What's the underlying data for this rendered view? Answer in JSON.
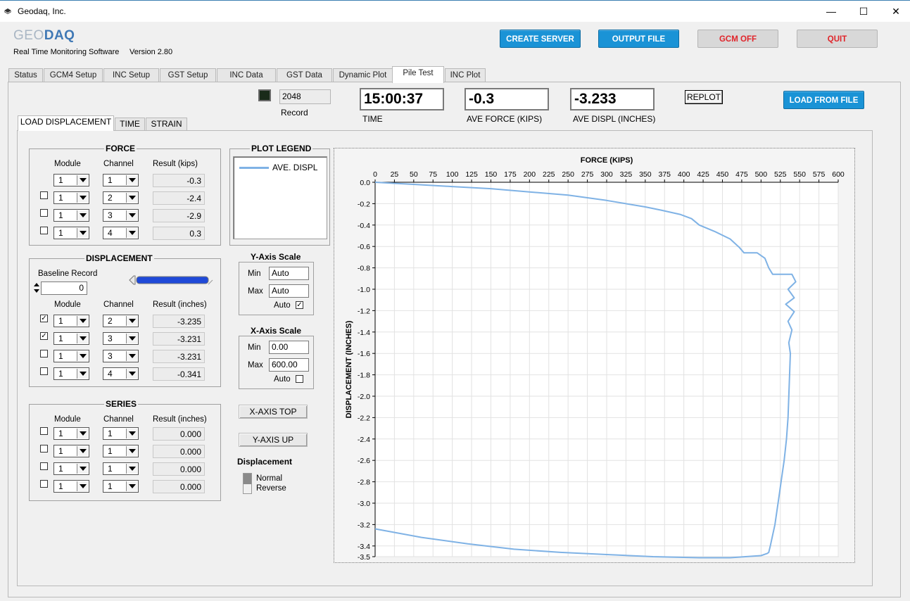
{
  "window": {
    "title": "Geodaq, Inc.",
    "minimize": "—",
    "maximize": "☐",
    "close": "✕"
  },
  "header": {
    "logo_geo": "GEO",
    "logo_daq": "DAQ",
    "subtitle": "Real Time Monitoring Software",
    "version": "Version 2.80",
    "buttons": {
      "create_server": "CREATE SERVER",
      "output_file": "OUTPUT FILE",
      "gcm_off": "GCM OFF",
      "quit": "QUIT"
    }
  },
  "tabs": [
    "Status",
    "GCM4 Setup",
    "INC Setup",
    "GST Setup",
    "INC Data",
    "GST Data",
    "Dynamic Plot",
    "Pile Test",
    "INC Plot"
  ],
  "readouts": {
    "record_value": "2048",
    "record_label": "Record",
    "time_value": "15:00:37",
    "time_label": "TIME",
    "force_value": "-0.3",
    "force_label": "AVE FORCE (KIPS)",
    "displ_value": "-3.233",
    "displ_label": "AVE DISPL (INCHES)",
    "replot": "REPLOT",
    "load_from_file": "LOAD FROM FILE"
  },
  "inner_tabs": [
    "LOAD DISPLACEMENT",
    "TIME",
    "STRAIN"
  ],
  "force_group": {
    "title": "FORCE",
    "col_module": "Module",
    "col_channel": "Channel",
    "col_result": "Result (kips)",
    "rows": [
      {
        "module": "1",
        "channel": "1",
        "result": "-0.3",
        "checked": null
      },
      {
        "module": "1",
        "channel": "2",
        "result": "-2.4",
        "checked": false
      },
      {
        "module": "1",
        "channel": "3",
        "result": "-2.9",
        "checked": false
      },
      {
        "module": "1",
        "channel": "4",
        "result": "0.3",
        "checked": false
      }
    ]
  },
  "displacement_group": {
    "title": "DISPLACEMENT",
    "baseline_label": "Baseline Record",
    "baseline_value": "0",
    "col_module": "Module",
    "col_channel": "Channel",
    "col_result": "Result (inches)",
    "rows": [
      {
        "module": "1",
        "channel": "2",
        "result": "-3.235",
        "checked": true
      },
      {
        "module": "1",
        "channel": "3",
        "result": "-3.231",
        "checked": true
      },
      {
        "module": "1",
        "channel": "3",
        "result": "-3.231",
        "checked": false
      },
      {
        "module": "1",
        "channel": "4",
        "result": "-0.341",
        "checked": false
      }
    ]
  },
  "series_group": {
    "title": "SERIES",
    "col_module": "Module",
    "col_channel": "Channel",
    "col_result": "Result (inches)",
    "rows": [
      {
        "module": "1",
        "channel": "1",
        "result": "0.000",
        "checked": false
      },
      {
        "module": "1",
        "channel": "1",
        "result": "0.000",
        "checked": false
      },
      {
        "module": "1",
        "channel": "1",
        "result": "0.000",
        "checked": false
      },
      {
        "module": "1",
        "channel": "1",
        "result": "0.000",
        "checked": false
      }
    ]
  },
  "legend": {
    "title": "PLOT LEGEND",
    "entry": "AVE. DISPL",
    "color": "#7fb2e5"
  },
  "y_axis_scale": {
    "title": "Y-Axis Scale",
    "min_label": "Min",
    "min": "Auto",
    "max_label": "Max",
    "max": "Auto",
    "auto_label": "Auto",
    "auto": true
  },
  "x_axis_scale": {
    "title": "X-Axis Scale",
    "min_label": "Min",
    "min": "0.00",
    "max_label": "Max",
    "max": "600.00",
    "auto_label": "Auto",
    "auto": false
  },
  "axis_buttons": {
    "x_axis_top": "X-AXIS TOP",
    "y_axis_up": "Y-AXIS UP"
  },
  "displacement_mode": {
    "title": "Displacement",
    "normal": "Normal",
    "reverse": "Reverse",
    "selected": "Normal"
  },
  "chart_data": {
    "type": "line",
    "title": "",
    "xlabel": "FORCE (KIPS)",
    "ylabel": "DISPLACEMENT (INCHES)",
    "xlim": [
      0,
      600
    ],
    "ylim": [
      -3.5,
      0
    ],
    "x_ticks": [
      "0",
      "25",
      "50",
      "75",
      "100",
      "125",
      "150",
      "175",
      "200",
      "225",
      "250",
      "275",
      "300",
      "325",
      "350",
      "375",
      "400",
      "425",
      "450",
      "475",
      "500",
      "525",
      "550",
      "575",
      "600"
    ],
    "y_ticks": [
      "0.0",
      "-0.2",
      "-0.4",
      "-0.6",
      "-0.8",
      "-1.0",
      "-1.2",
      "-1.4",
      "-1.6",
      "-1.8",
      "-2.0",
      "-2.2",
      "-2.4",
      "-2.6",
      "-2.8",
      "-3.0",
      "-3.2",
      "-3.4",
      "-3.5"
    ],
    "x_axis_position": "top",
    "grid": true,
    "series": [
      {
        "name": "AVE. DISPL",
        "color": "#7fb2e5",
        "x": [
          0,
          50,
          100,
          150,
          200,
          250,
          300,
          350,
          370,
          395,
          410,
          420,
          440,
          460,
          472,
          478,
          495,
          505,
          510,
          515,
          540,
          545,
          535,
          543,
          532,
          543,
          535,
          540,
          536,
          538,
          537,
          536,
          535,
          533,
          530,
          528,
          526,
          524,
          522,
          520,
          518,
          515,
          512,
          510,
          508,
          500,
          480,
          460,
          420,
          360,
          300,
          240,
          180,
          120,
          60,
          0
        ],
        "y": [
          0.0,
          -0.02,
          -0.04,
          -0.06,
          -0.09,
          -0.12,
          -0.17,
          -0.23,
          -0.26,
          -0.3,
          -0.34,
          -0.4,
          -0.46,
          -0.53,
          -0.61,
          -0.66,
          -0.66,
          -0.71,
          -0.8,
          -0.86,
          -0.86,
          -0.93,
          -1.0,
          -1.08,
          -1.14,
          -1.21,
          -1.3,
          -1.38,
          -1.5,
          -1.6,
          -1.8,
          -2.0,
          -2.2,
          -2.4,
          -2.6,
          -2.7,
          -2.8,
          -2.9,
          -3.0,
          -3.1,
          -3.2,
          -3.3,
          -3.4,
          -3.46,
          -3.47,
          -3.49,
          -3.5,
          -3.51,
          -3.51,
          -3.5,
          -3.48,
          -3.46,
          -3.43,
          -3.38,
          -3.32,
          -3.24
        ]
      }
    ]
  }
}
